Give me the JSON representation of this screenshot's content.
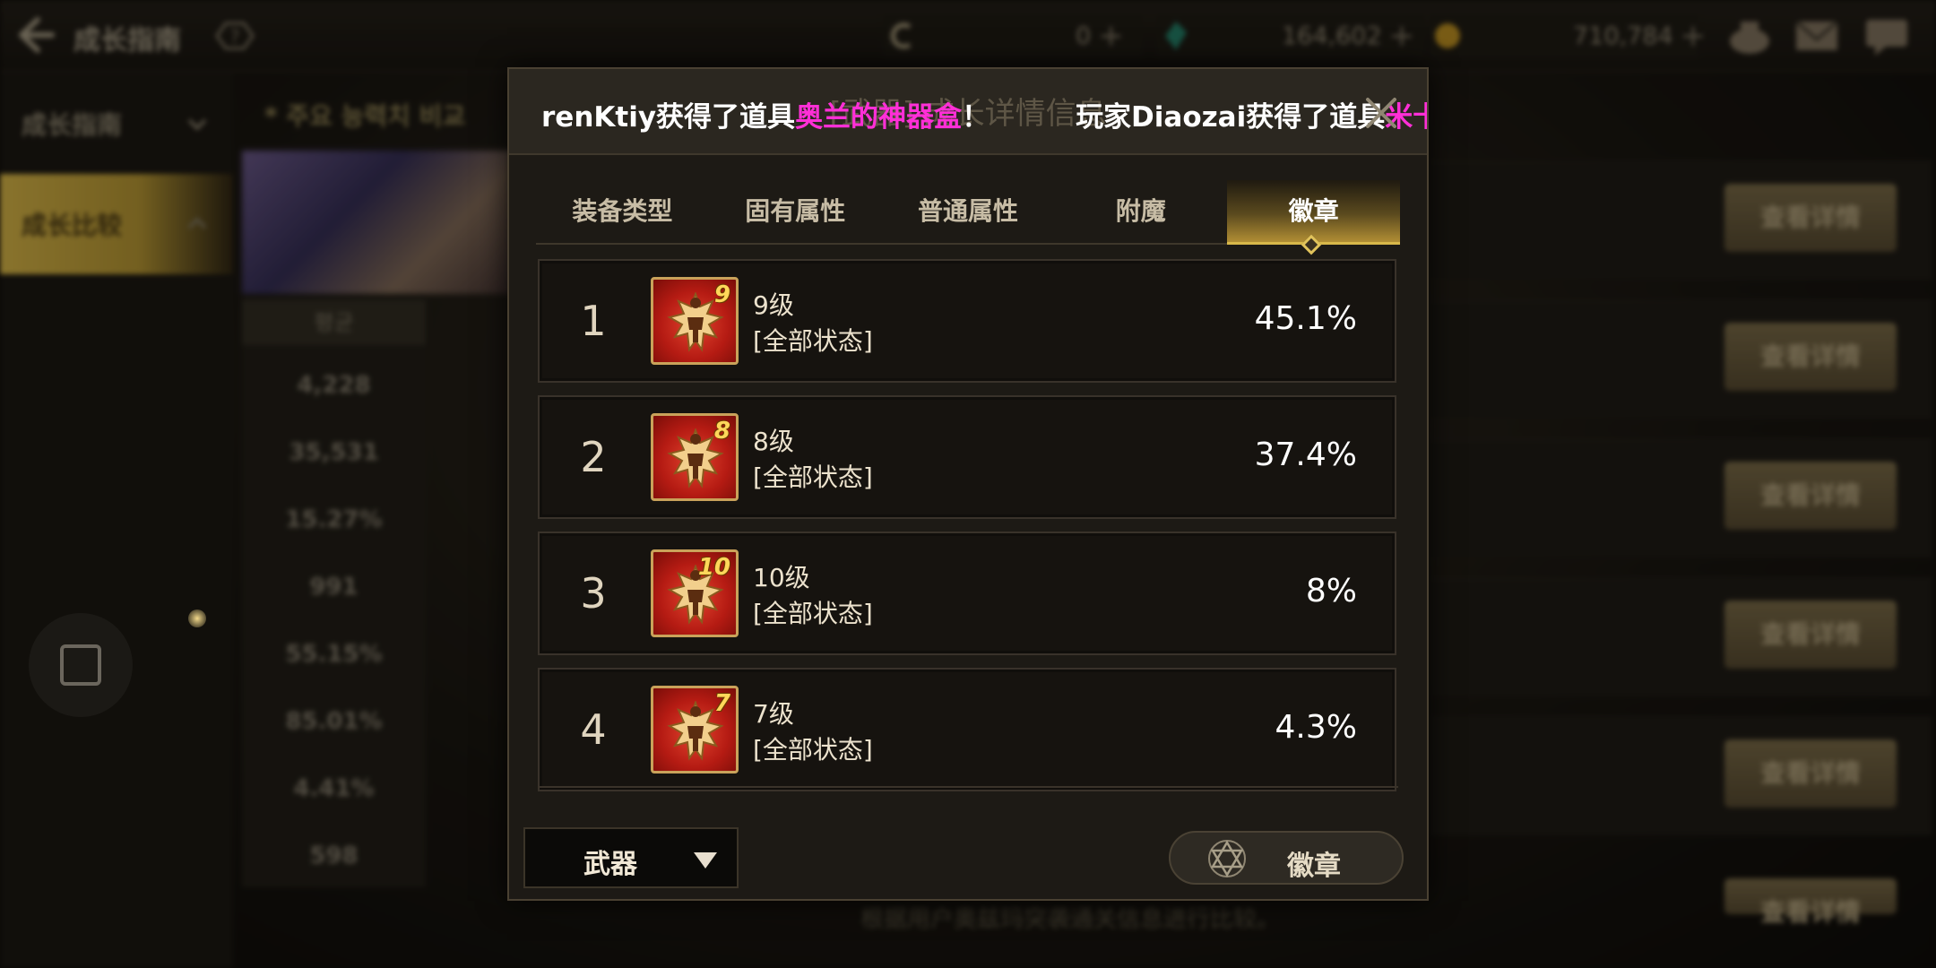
{
  "background": {
    "top_title": "成长指南",
    "currencies": [
      {
        "icon": "coin-c-icon",
        "value": "0"
      },
      {
        "icon": "green-gem-icon",
        "value": "164,602"
      },
      {
        "icon": "gold-coin-icon",
        "value": "710,784"
      }
    ],
    "sidebar": [
      {
        "label": "成长指南",
        "active": false
      },
      {
        "label": "成长比较",
        "active": true
      }
    ],
    "sub_header": "* 주요 능력치 비교",
    "stats_header": "평균",
    "stats": [
      "4,228",
      "35,531",
      "15.27%",
      "991",
      "55.15%",
      "85.01%",
      "4.41%",
      "598"
    ],
    "detail_buttons": [
      "查看详情",
      "查看详情",
      "查看详情",
      "查看详情",
      "查看详情",
      "查看详情"
    ],
    "footer_note": "根据用户奥兹玛突袭通关信息进行比较。"
  },
  "modal": {
    "title": "[武器] 成长详情信息",
    "ticker": [
      {
        "prefix": "renKtiy获得了道具",
        "item": "奥兰的神器盒",
        "suffix": "！"
      },
      {
        "prefix": "玩家Diaozai获得了道具",
        "item": "米卡埃",
        "suffix": ""
      }
    ],
    "tabs": [
      "装备类型",
      "固有属性",
      "普通属性",
      "附魔",
      "徽章"
    ],
    "active_tab": "徽章",
    "rows": [
      {
        "rank": "1",
        "badge_level": "9",
        "level": "9级",
        "stat": "[全部状态]",
        "percent": "45.1%"
      },
      {
        "rank": "2",
        "badge_level": "8",
        "level": "8级",
        "stat": "[全部状态]",
        "percent": "37.4%"
      },
      {
        "rank": "3",
        "badge_level": "10",
        "level": "10级",
        "stat": "[全部状态]",
        "percent": "8%"
      },
      {
        "rank": "4",
        "badge_level": "7",
        "level": "7级",
        "stat": "[全部状态]",
        "percent": "4.3%"
      }
    ],
    "weapon_select": "武器",
    "emblem_button": "徽章"
  },
  "colors": {
    "accent_gold": "#d8b84a",
    "ticker_highlight": "#ff2fd7",
    "badge_red": "#b51b13"
  }
}
